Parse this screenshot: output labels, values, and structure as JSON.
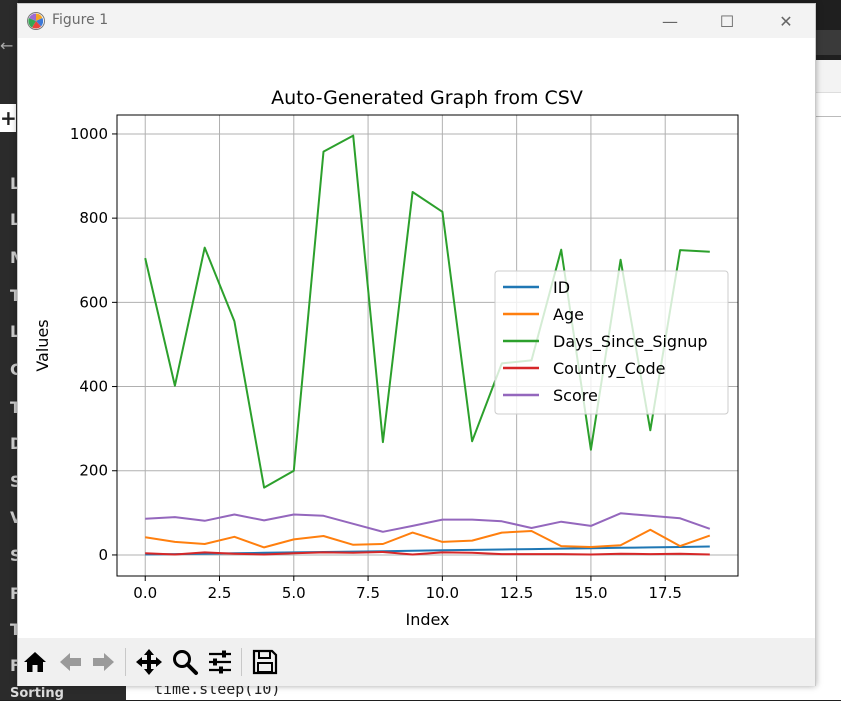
{
  "window": {
    "title": "Figure 1",
    "minimize_label": "—",
    "maximize_label": "☐",
    "close_label": "✕"
  },
  "toolbar": {
    "icons": [
      "home-icon",
      "back-icon",
      "forward-icon",
      "pan-icon",
      "zoom-icon",
      "configure-subplots-icon",
      "save-icon"
    ]
  },
  "background": {
    "code_line": "time.sleep(10)",
    "sidebar_letters": [
      "L",
      "L",
      "M",
      "T",
      "L",
      "C",
      "T",
      "D",
      "S",
      "V",
      "S",
      "F",
      "T",
      "F"
    ],
    "sidebar_bottom_text": "Sorting"
  },
  "chart_data": {
    "type": "line",
    "title": "Auto-Generated Graph from CSV",
    "xlabel": "Index",
    "ylabel": "Values",
    "xlim": [
      -0.95,
      19.95
    ],
    "ylim": [
      -50,
      1045
    ],
    "xticks": [
      0.0,
      2.5,
      5.0,
      7.5,
      10.0,
      12.5,
      15.0,
      17.5
    ],
    "xtick_labels": [
      "0.0",
      "2.5",
      "5.0",
      "7.5",
      "10.0",
      "12.5",
      "15.0",
      "17.5"
    ],
    "yticks": [
      0,
      200,
      400,
      600,
      800,
      1000
    ],
    "ytick_labels": [
      "0",
      "200",
      "400",
      "600",
      "800",
      "1000"
    ],
    "grid": true,
    "legend_position": "center-right",
    "x": [
      0,
      1,
      2,
      3,
      4,
      5,
      6,
      7,
      8,
      9,
      10,
      11,
      12,
      13,
      14,
      15,
      16,
      17,
      18,
      19
    ],
    "series": [
      {
        "name": "ID",
        "color": "#1f77b4",
        "values": [
          1,
          2,
          3,
          4,
          5,
          6,
          7,
          8,
          9,
          10,
          11,
          12,
          13,
          14,
          15,
          16,
          17,
          18,
          19,
          20
        ]
      },
      {
        "name": "Age",
        "color": "#ff7f0e",
        "values": [
          42,
          31,
          26,
          43,
          18,
          37,
          45,
          24,
          26,
          53,
          31,
          34,
          53,
          57,
          21,
          19,
          23,
          60,
          21,
          46
        ]
      },
      {
        "name": "Days_Since_Signup",
        "color": "#2ca02c",
        "values": [
          705,
          402,
          730,
          555,
          160,
          200,
          958,
          996,
          268,
          862,
          815,
          270,
          455,
          462,
          725,
          250,
          701,
          296,
          724,
          720
        ]
      },
      {
        "name": "Country_Code",
        "color": "#d62728",
        "values": [
          4,
          1,
          6,
          3,
          1,
          4,
          6,
          5,
          7,
          1,
          6,
          5,
          2,
          2,
          2,
          1,
          3,
          2,
          3,
          1
        ]
      },
      {
        "name": "Score",
        "color": "#9467bd",
        "values": [
          86,
          90,
          81,
          96,
          82,
          96,
          93,
          74,
          55,
          69,
          84,
          84,
          80,
          64,
          79,
          69,
          99,
          93,
          87,
          62
        ]
      }
    ]
  }
}
